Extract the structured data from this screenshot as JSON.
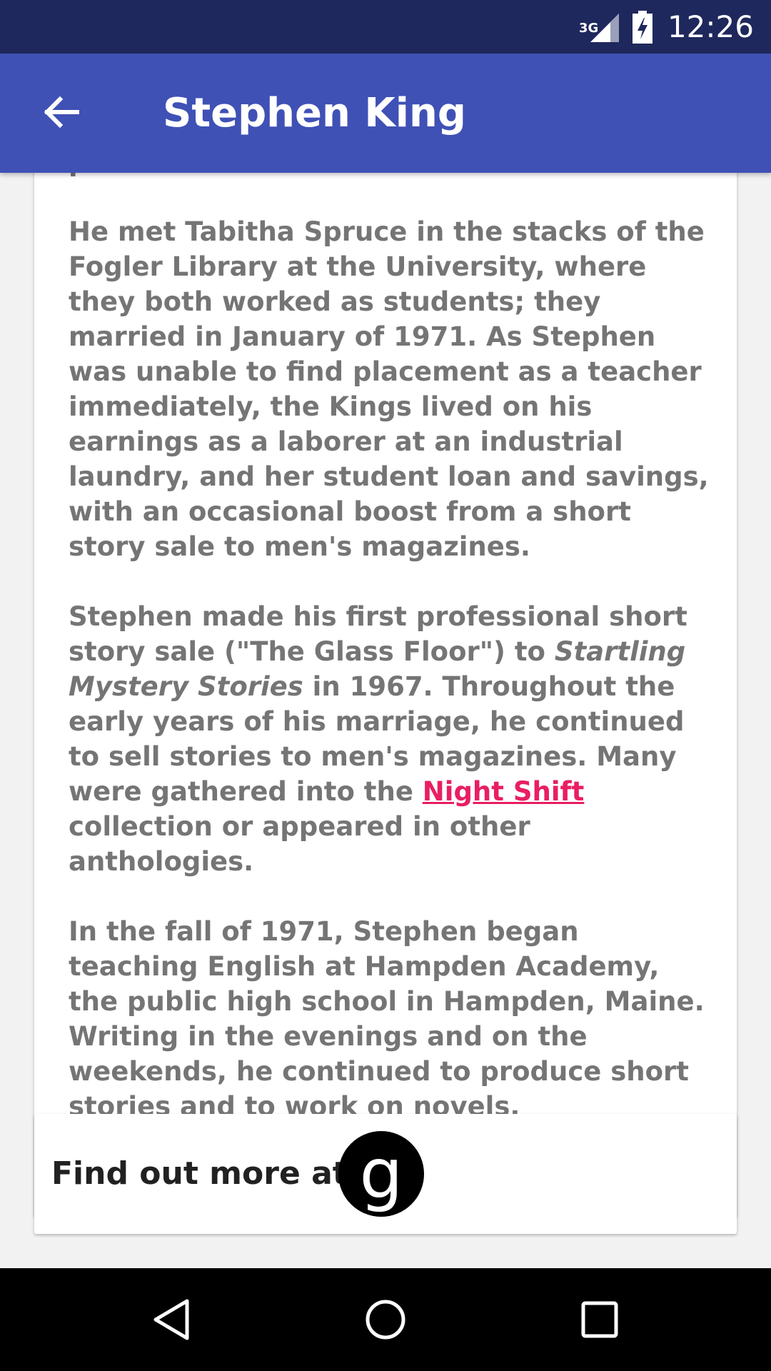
{
  "status_bar": {
    "network": "3G",
    "time": "12:26"
  },
  "app_bar": {
    "title": "Stephen King",
    "back_icon": "arrow-back-icon"
  },
  "bio": {
    "partial_line": "punctured eardrums.",
    "paragraph_1": "He met Tabitha Spruce in the stacks of the Fogler Library at the University, where they both worked as students; they married in January of 1971. As Stephen was unable to find placement as a teacher immediately, the Kings lived on his earnings as a laborer at an industrial laundry, and her student loan and savings, with an occasional boost from a short story sale to men's magazines.",
    "paragraph_2_a": "Stephen made his first professional short story sale (\"The Glass Floor\") to ",
    "paragraph_2_italic": "Startling Mystery Stories",
    "paragraph_2_b": " in 1967. Throughout the early years of his marriage, he continued to sell stories to men's magazines. Many were gathered into the ",
    "paragraph_2_link": "Night Shift",
    "paragraph_2_c": " collection or appeared in other anthologies.",
    "paragraph_3": "In the fall of 1971, Stephen began teaching English at Hampden Academy, the public high school in Hampden, Maine. Writing in the evenings and on the weekends, he continued to produce short stories and to work on novels.",
    "link_color": "#e91e63"
  },
  "more": {
    "label": "Find out more at",
    "logo_letter": "g",
    "logo_icon": "goodreads-logo-icon"
  },
  "nav_bar": {
    "back": "nav-back-icon",
    "home": "nav-home-icon",
    "recents": "nav-recents-icon"
  },
  "colors": {
    "status_bar": "#1f285c",
    "app_bar": "#3f51b5",
    "text": "#757575"
  }
}
